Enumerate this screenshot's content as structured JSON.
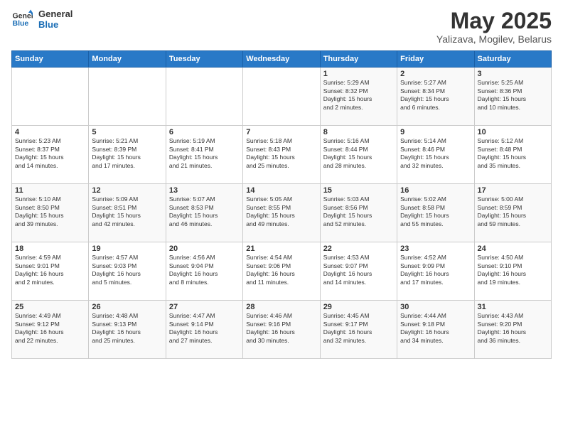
{
  "logo": {
    "line1": "General",
    "line2": "Blue"
  },
  "title": "May 2025",
  "subtitle": "Yalizava, Mogilev, Belarus",
  "days_of_week": [
    "Sunday",
    "Monday",
    "Tuesday",
    "Wednesday",
    "Thursday",
    "Friday",
    "Saturday"
  ],
  "weeks": [
    [
      {
        "day": "",
        "info": ""
      },
      {
        "day": "",
        "info": ""
      },
      {
        "day": "",
        "info": ""
      },
      {
        "day": "",
        "info": ""
      },
      {
        "day": "1",
        "info": "Sunrise: 5:29 AM\nSunset: 8:32 PM\nDaylight: 15 hours\nand 2 minutes."
      },
      {
        "day": "2",
        "info": "Sunrise: 5:27 AM\nSunset: 8:34 PM\nDaylight: 15 hours\nand 6 minutes."
      },
      {
        "day": "3",
        "info": "Sunrise: 5:25 AM\nSunset: 8:36 PM\nDaylight: 15 hours\nand 10 minutes."
      }
    ],
    [
      {
        "day": "4",
        "info": "Sunrise: 5:23 AM\nSunset: 8:37 PM\nDaylight: 15 hours\nand 14 minutes."
      },
      {
        "day": "5",
        "info": "Sunrise: 5:21 AM\nSunset: 8:39 PM\nDaylight: 15 hours\nand 17 minutes."
      },
      {
        "day": "6",
        "info": "Sunrise: 5:19 AM\nSunset: 8:41 PM\nDaylight: 15 hours\nand 21 minutes."
      },
      {
        "day": "7",
        "info": "Sunrise: 5:18 AM\nSunset: 8:43 PM\nDaylight: 15 hours\nand 25 minutes."
      },
      {
        "day": "8",
        "info": "Sunrise: 5:16 AM\nSunset: 8:44 PM\nDaylight: 15 hours\nand 28 minutes."
      },
      {
        "day": "9",
        "info": "Sunrise: 5:14 AM\nSunset: 8:46 PM\nDaylight: 15 hours\nand 32 minutes."
      },
      {
        "day": "10",
        "info": "Sunrise: 5:12 AM\nSunset: 8:48 PM\nDaylight: 15 hours\nand 35 minutes."
      }
    ],
    [
      {
        "day": "11",
        "info": "Sunrise: 5:10 AM\nSunset: 8:50 PM\nDaylight: 15 hours\nand 39 minutes."
      },
      {
        "day": "12",
        "info": "Sunrise: 5:09 AM\nSunset: 8:51 PM\nDaylight: 15 hours\nand 42 minutes."
      },
      {
        "day": "13",
        "info": "Sunrise: 5:07 AM\nSunset: 8:53 PM\nDaylight: 15 hours\nand 46 minutes."
      },
      {
        "day": "14",
        "info": "Sunrise: 5:05 AM\nSunset: 8:55 PM\nDaylight: 15 hours\nand 49 minutes."
      },
      {
        "day": "15",
        "info": "Sunrise: 5:03 AM\nSunset: 8:56 PM\nDaylight: 15 hours\nand 52 minutes."
      },
      {
        "day": "16",
        "info": "Sunrise: 5:02 AM\nSunset: 8:58 PM\nDaylight: 15 hours\nand 55 minutes."
      },
      {
        "day": "17",
        "info": "Sunrise: 5:00 AM\nSunset: 8:59 PM\nDaylight: 15 hours\nand 59 minutes."
      }
    ],
    [
      {
        "day": "18",
        "info": "Sunrise: 4:59 AM\nSunset: 9:01 PM\nDaylight: 16 hours\nand 2 minutes."
      },
      {
        "day": "19",
        "info": "Sunrise: 4:57 AM\nSunset: 9:03 PM\nDaylight: 16 hours\nand 5 minutes."
      },
      {
        "day": "20",
        "info": "Sunrise: 4:56 AM\nSunset: 9:04 PM\nDaylight: 16 hours\nand 8 minutes."
      },
      {
        "day": "21",
        "info": "Sunrise: 4:54 AM\nSunset: 9:06 PM\nDaylight: 16 hours\nand 11 minutes."
      },
      {
        "day": "22",
        "info": "Sunrise: 4:53 AM\nSunset: 9:07 PM\nDaylight: 16 hours\nand 14 minutes."
      },
      {
        "day": "23",
        "info": "Sunrise: 4:52 AM\nSunset: 9:09 PM\nDaylight: 16 hours\nand 17 minutes."
      },
      {
        "day": "24",
        "info": "Sunrise: 4:50 AM\nSunset: 9:10 PM\nDaylight: 16 hours\nand 19 minutes."
      }
    ],
    [
      {
        "day": "25",
        "info": "Sunrise: 4:49 AM\nSunset: 9:12 PM\nDaylight: 16 hours\nand 22 minutes."
      },
      {
        "day": "26",
        "info": "Sunrise: 4:48 AM\nSunset: 9:13 PM\nDaylight: 16 hours\nand 25 minutes."
      },
      {
        "day": "27",
        "info": "Sunrise: 4:47 AM\nSunset: 9:14 PM\nDaylight: 16 hours\nand 27 minutes."
      },
      {
        "day": "28",
        "info": "Sunrise: 4:46 AM\nSunset: 9:16 PM\nDaylight: 16 hours\nand 30 minutes."
      },
      {
        "day": "29",
        "info": "Sunrise: 4:45 AM\nSunset: 9:17 PM\nDaylight: 16 hours\nand 32 minutes."
      },
      {
        "day": "30",
        "info": "Sunrise: 4:44 AM\nSunset: 9:18 PM\nDaylight: 16 hours\nand 34 minutes."
      },
      {
        "day": "31",
        "info": "Sunrise: 4:43 AM\nSunset: 9:20 PM\nDaylight: 16 hours\nand 36 minutes."
      }
    ]
  ]
}
